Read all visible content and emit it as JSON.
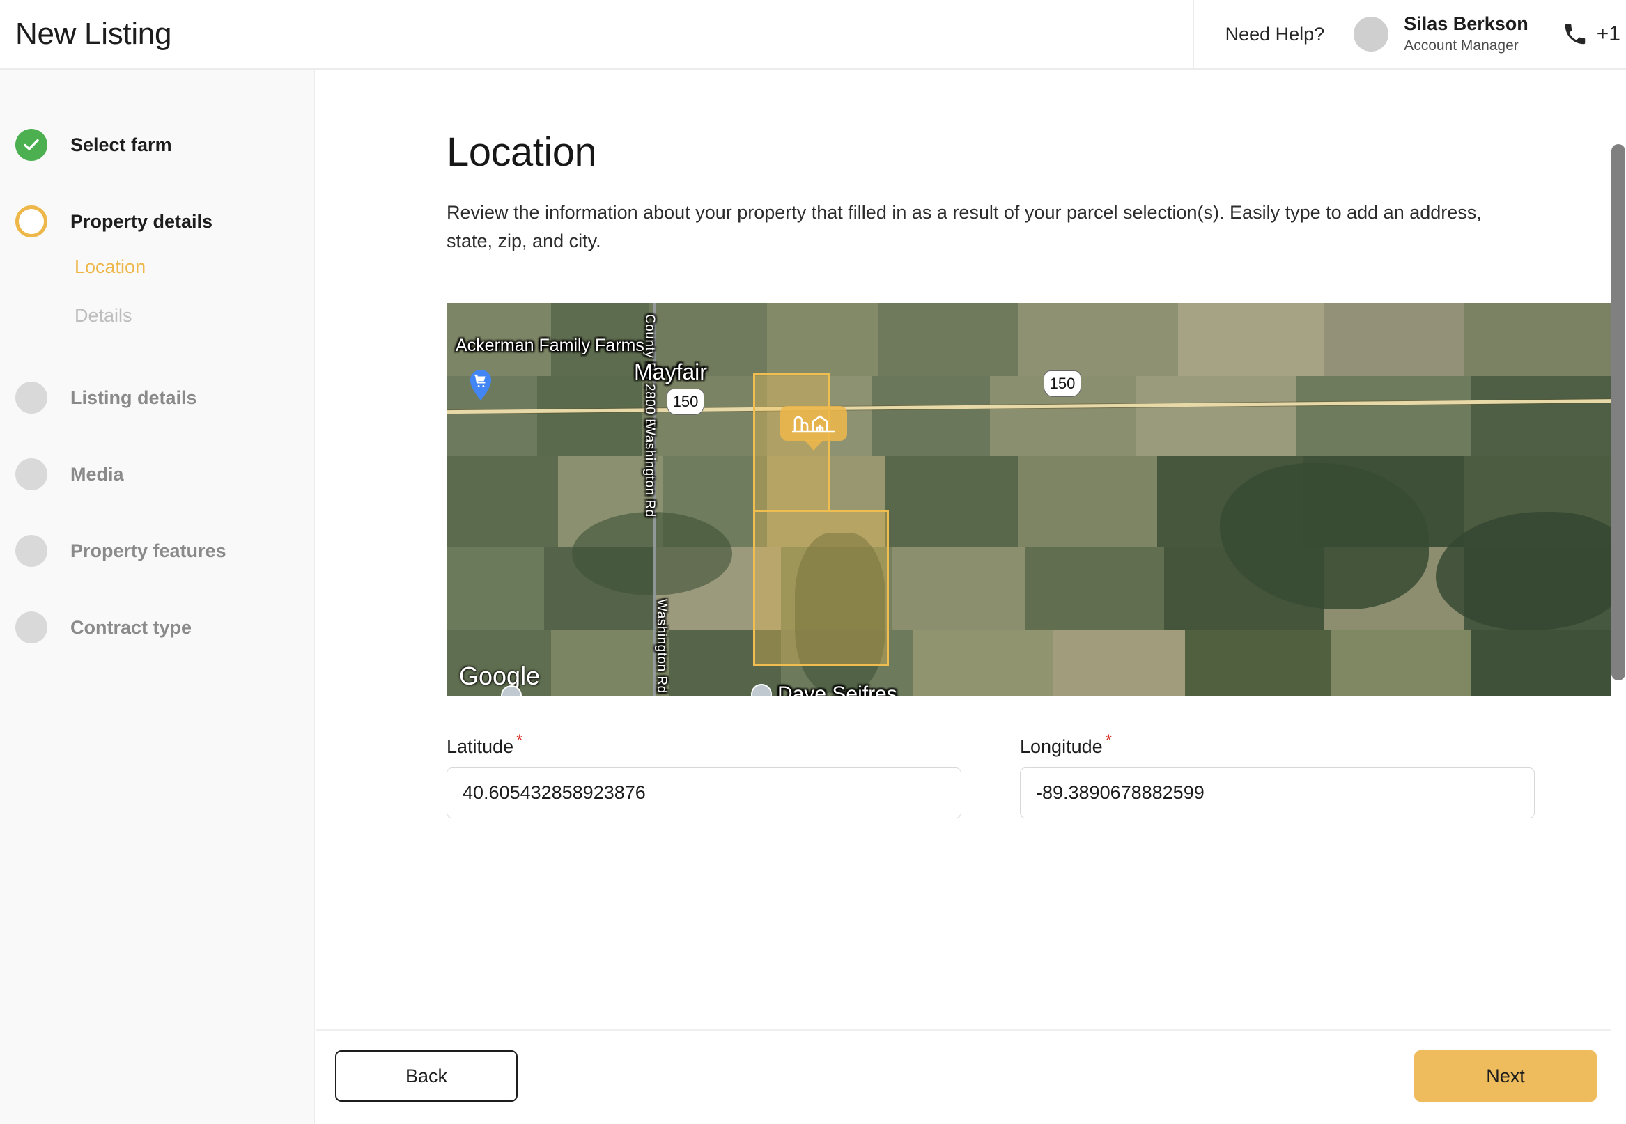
{
  "header": {
    "title": "New Listing",
    "need_help": "Need Help?",
    "account_manager_name": "Silas Berkson",
    "account_manager_role": "Account Manager",
    "phone_number": "+1",
    "phone_icon": "phone-icon",
    "avatar_icon": "avatar-placeholder"
  },
  "sidebar": {
    "steps": [
      {
        "label": "Select farm",
        "state": "done"
      },
      {
        "label": "Property details",
        "state": "current"
      },
      {
        "label": "Listing details",
        "state": "todo"
      },
      {
        "label": "Media",
        "state": "todo"
      },
      {
        "label": "Property features",
        "state": "todo"
      },
      {
        "label": "Contract type",
        "state": "todo"
      }
    ],
    "substeps": [
      {
        "label": "Location",
        "state": "active"
      },
      {
        "label": "Details",
        "state": "idle"
      }
    ]
  },
  "main": {
    "page_title": "Location",
    "description": "Review the information about your property that filled in as a result of your parcel selection(s). Easily type to add an address, state, zip, and city."
  },
  "map": {
    "attribution": "Google",
    "labels": [
      "Ackerman Family Farms",
      "Mayfair",
      "Dave Seifres"
    ],
    "road_labels": [
      "County Rd 2800 E",
      "Washington Rd",
      "Washington Rd"
    ],
    "highway_shields": [
      "150",
      "150"
    ],
    "poi_icons": [
      "shopping-cart-pin-icon",
      "place-circle-icon"
    ],
    "parcel_marker_icon": "farm-barn-icon",
    "parcel_outline_color": "#f0be50",
    "parcel_fill_color": "rgba(240,190,80,0.34)"
  },
  "form": {
    "latitude": {
      "label": "Latitude",
      "required_mark": "*",
      "value": "40.605432858923876"
    },
    "longitude": {
      "label": "Longitude",
      "required_mark": "*",
      "value": "-89.3890678882599"
    }
  },
  "footer": {
    "back_label": "Back",
    "next_label": "Next",
    "next_color": "#eebc5c"
  }
}
